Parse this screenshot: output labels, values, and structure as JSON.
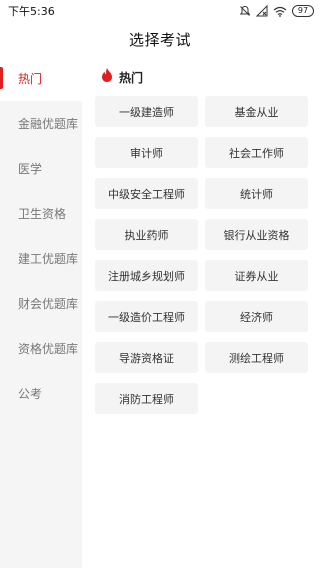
{
  "status_bar": {
    "time": "下午5:36",
    "battery": "97",
    "icons": [
      "mute-icon",
      "no-signal-icon",
      "wifi-icon",
      "battery-icon"
    ]
  },
  "header": {
    "title": "选择考试"
  },
  "sidebar": {
    "items": [
      {
        "label": "热门",
        "active": true
      },
      {
        "label": "金融优题库",
        "active": false
      },
      {
        "label": "医学",
        "active": false
      },
      {
        "label": "卫生资格",
        "active": false
      },
      {
        "label": "建工优题库",
        "active": false
      },
      {
        "label": "财会优题库",
        "active": false
      },
      {
        "label": "资格优题库",
        "active": false
      },
      {
        "label": "公考",
        "active": false
      }
    ]
  },
  "main": {
    "section_icon": "flame-icon",
    "section_title": "热门",
    "exams": [
      "一级建造师",
      "基金从业",
      "审计师",
      "社会工作师",
      "中级安全工程师",
      "统计师",
      "执业药师",
      "银行从业资格",
      "注册城乡规划师",
      "证券从业",
      "一级造价工程师",
      "经济师",
      "导游资格证",
      "测绘工程师",
      "消防工程师"
    ]
  },
  "colors": {
    "accent": "#e02020",
    "sidebar_bg": "#f5f5f5",
    "chip_bg": "#f4f4f4"
  }
}
